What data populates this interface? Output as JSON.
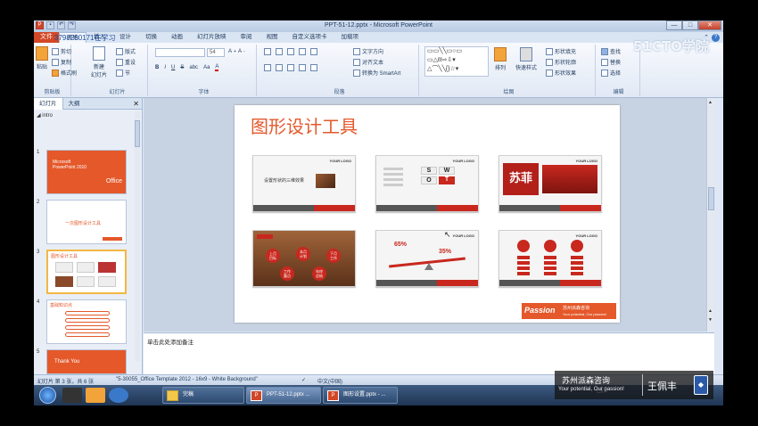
{
  "window": {
    "title": "PPT-51-12.pptx - Microsoft PowerPoint",
    "min": "—",
    "max": "□",
    "close": "✕"
  },
  "overlay_qq": "3798250171在学习",
  "ribbon": {
    "file_tab": "文件",
    "tabs": [
      "开始",
      "插入",
      "设计",
      "切换",
      "动画",
      "幻灯片放映",
      "审阅",
      "视图",
      "自定义选项卡",
      "加载项"
    ],
    "clipboard": {
      "paste": "粘贴",
      "cut": "剪切",
      "copy": "复制",
      "format_painter": "格式刷",
      "label": "剪贴板"
    },
    "slides": {
      "new_slide": "新建\n幻灯片",
      "layout": "版式",
      "reset": "重设",
      "section": "节",
      "label": "幻灯片"
    },
    "font": {
      "size": "54",
      "bold": "B",
      "italic": "I",
      "underline": "U",
      "strike": "S",
      "label": "字体"
    },
    "paragraph": {
      "text_direction": "文字方向",
      "align_text": "对齐文本",
      "smartart": "转换为 SmartArt",
      "label": "段落"
    },
    "drawing": {
      "arrange": "排列",
      "quick_styles": "快速样式",
      "fill": "形状填充",
      "outline": "形状轮廓",
      "effects": "形状效果",
      "label": "绘图"
    },
    "editing": {
      "find": "查找",
      "replace": "替换",
      "select": "选择",
      "label": "编辑"
    }
  },
  "watermark_site": "51CTO学院",
  "left_pane": {
    "tabs": [
      "幻灯片",
      "大纲"
    ],
    "close": "✕",
    "section": "intro",
    "thumbnails": [
      {
        "num": "1",
        "title": "Microsoft PowerPoint 2010",
        "sub": "Office"
      },
      {
        "num": "2",
        "title": "一次图形设计工具"
      },
      {
        "num": "3",
        "title": "图形设计工具"
      },
      {
        "num": "4",
        "title": "基础知识点"
      },
      {
        "num": "5",
        "title": "Thank You"
      }
    ]
  },
  "slide": {
    "title": "图形设计工具",
    "card1_text": "设置形状的三维效果",
    "brand": "YOUR LOGO",
    "passion": {
      "word": "Passion",
      "cn": "苏州派森咨询",
      "en": "Your potential, Our passion!"
    },
    "card5_labels": [
      "上月\n目标",
      "本月\n计划",
      "下月\n工作",
      "工作\n重点",
      "年终\n总结"
    ],
    "card6_pct1": "65%",
    "card6_pct2": "35%"
  },
  "notes_placeholder": "单击此处添加备注",
  "status": {
    "slide_info": "幻灯片 第 3 张，共 6 张",
    "theme": "\"5-30055_Office Template 2012 - 16x9 - White Background\"",
    "language": "中文(中国)"
  },
  "taskbar": {
    "tasks": [
      {
        "label": "完稿",
        "type": "folder"
      },
      {
        "label": "PPT-51-12.pptx ...",
        "type": "ppt"
      },
      {
        "label": "图形设置.pptx - ...",
        "type": "ppt"
      }
    ]
  },
  "brandbox": {
    "cn": "苏州派森咨询",
    "en": "Your potential, Our passion!",
    "name": "王佩丰"
  },
  "colors": {
    "accent": "#e4582a",
    "file_tab": "#d24726",
    "ribbon_bg": "#e1e9f5"
  }
}
